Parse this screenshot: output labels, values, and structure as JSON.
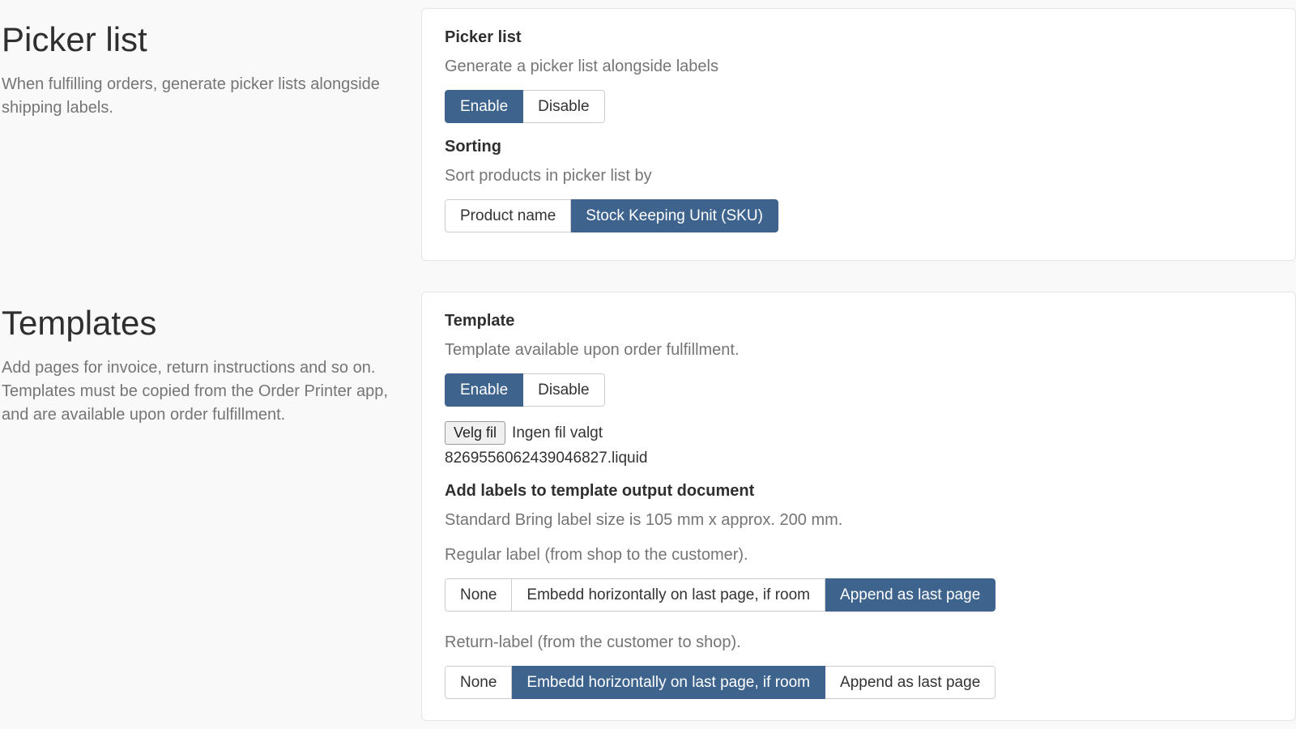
{
  "picker": {
    "left_heading": "Picker list",
    "left_description": "When fulfilling orders, generate picker lists alongside shipping labels.",
    "card_heading": "Picker list",
    "card_subtext": "Generate a picker list alongside labels",
    "toggle": {
      "enable": "Enable",
      "disable": "Disable"
    },
    "sorting_heading": "Sorting",
    "sorting_subtext": "Sort products in picker list by",
    "sorting_options": {
      "product_name": "Product name",
      "sku": "Stock Keeping Unit (SKU)"
    }
  },
  "templates": {
    "left_heading": "Templates",
    "left_description": "Add pages for invoice, return instructions and so on. Templates must be copied from the Order Printer app, and are available upon order fulfillment.",
    "card_heading": "Template",
    "card_subtext": "Template available upon order fulfillment.",
    "toggle": {
      "enable": "Enable",
      "disable": "Disable"
    },
    "file": {
      "button": "Velg fil",
      "status": "Ingen fil valgt",
      "name": "8269556062439046827.liquid"
    },
    "labels_heading": "Add labels to template output document",
    "labels_subtext": "Standard Bring label size is 105 mm x approx. 200 mm.",
    "regular_subtext": "Regular label (from shop to the customer).",
    "return_subtext": "Return-label (from the customer to shop).",
    "label_options": {
      "none": "None",
      "embed": "Embedd horizontally on last page, if room",
      "append": "Append as last page"
    }
  }
}
